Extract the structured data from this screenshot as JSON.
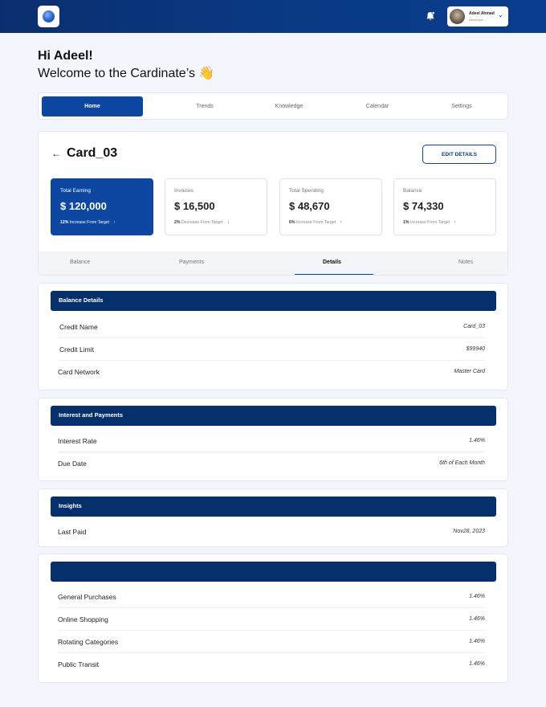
{
  "header": {
    "user_name": "Adeel Ahmad",
    "user_role": "Developer"
  },
  "greeting": "Hi Adeel!",
  "welcome": "Welcome to the Cardinate’s 👋",
  "nav": [
    "Home",
    "Trends",
    "Knowledge",
    "Calendar",
    "Settings"
  ],
  "card": {
    "title": "Card_03",
    "edit_label": "EDIT DETAILS",
    "stats": [
      {
        "label": "Total Earning",
        "value": "$ 120,000",
        "pct": "12%",
        "note": "Increase From Target",
        "arrow": "↑"
      },
      {
        "label": "Invoices",
        "value": "$ 16,500",
        "pct": "2%",
        "note": "Decrease From Target",
        "arrow": "↓"
      },
      {
        "label": "Total Spending",
        "value": "$ 48,670",
        "pct": "6%",
        "note": "Increase From Target",
        "arrow": "↑"
      },
      {
        "label": "Balance",
        "value": "$ 74,330",
        "pct": "1%",
        "note": "Increase From Target",
        "arrow": "↑"
      }
    ],
    "tabs": [
      "Balance",
      "Payments",
      "Details",
      "Notes"
    ]
  },
  "sections": [
    {
      "title": "Balance Details",
      "rows": [
        {
          "label": "Credit Name",
          "value": "Card_03"
        },
        {
          "label": "Credit Limit",
          "value": "$99940"
        },
        {
          "label": "Card Network",
          "value": "Master Card"
        }
      ]
    },
    {
      "title": "Interest and Payments",
      "rows": [
        {
          "label": "Interest Rate",
          "value": "1.46%"
        },
        {
          "label": "Due Date",
          "value": "6th of Each Month"
        }
      ]
    },
    {
      "title": "Insights",
      "rows": [
        {
          "label": "Last Paid",
          "value": "Nov28,  2023"
        }
      ]
    },
    {
      "title": "",
      "rows": [
        {
          "label": "General Purchases",
          "value": "1.46%"
        },
        {
          "label": "Online Shopping",
          "value": "1.46%"
        },
        {
          "label": "Rotating Categories",
          "value": "1.46%"
        },
        {
          "label": "Public Transit",
          "value": "1.46%"
        }
      ]
    }
  ]
}
